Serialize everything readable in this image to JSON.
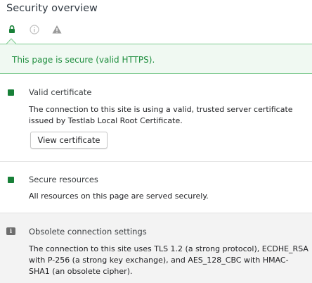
{
  "header": {
    "title": "Security overview",
    "tabs": [
      {
        "icon": "lock-icon",
        "state": "selected",
        "color": "#188038"
      },
      {
        "icon": "info-circle-icon",
        "state": "inactive",
        "color": "#c0c0c0"
      },
      {
        "icon": "warning-triangle-icon",
        "state": "inactive",
        "color": "#9a9a9a"
      }
    ]
  },
  "banner": {
    "text": "This page is secure (valid HTTPS).",
    "text_color": "#1e8e3e",
    "background": "#f0f9f2",
    "border_color": "#7fcb91"
  },
  "sections": {
    "certificate": {
      "title": "Valid certificate",
      "body": "The connection to this site is using a valid, trusted server certificate issued by Testlab Local Root Certificate.",
      "button_label": "View certificate",
      "status_color": "#188038"
    },
    "resources": {
      "title": "Secure resources",
      "body": "All resources on this page are served securely.",
      "status_color": "#188038"
    },
    "obsolete": {
      "title": "Obsolete connection settings",
      "body": "The connection to this site uses TLS 1.2 (a strong protocol), ECDHE_RSA with P-256 (a strong key exchange), and AES_128_CBC with HMAC-SHA1 (an obsolete cipher).",
      "badge": "i",
      "status_color": "#6e6e6e"
    }
  }
}
